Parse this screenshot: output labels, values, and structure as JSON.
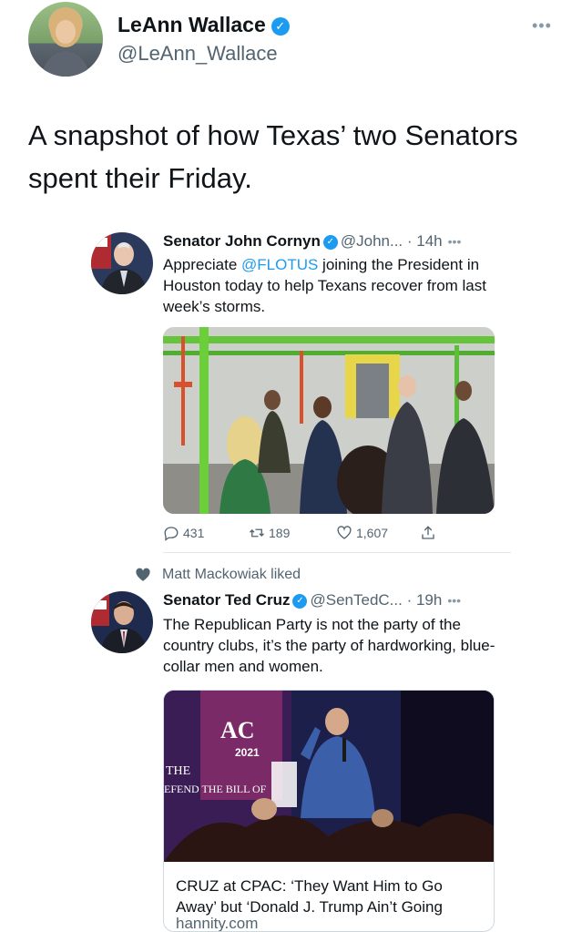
{
  "author": {
    "display_name": "LeAnn Wallace",
    "handle": "@LeAnn_Wallace",
    "more": "•••"
  },
  "tweet": {
    "text": "A snapshot of how Texas’ two Senators spent their Friday."
  },
  "quote1": {
    "name": "Senator John Cornyn",
    "handle": "@John...",
    "time": "· 14h",
    "more": "•••",
    "text_pre": "Appreciate ",
    "mention": "@FLOTUS",
    "text_post": " joining the President in Houston today to help Texans recover from last week’s storms.",
    "replies": "431",
    "retweets": "189",
    "likes": "1,607"
  },
  "liked_by": {
    "text": "Matt Mackowiak liked"
  },
  "quote2": {
    "name": "Senator Ted Cruz",
    "handle": "@SenTedC...",
    "time": "· 19h",
    "more": "•••",
    "text": "The Republican Party is not the party of the country clubs, it’s the party of hardworking, blue-collar men and women.",
    "card_sign_1": "AC",
    "card_sign_2": "2021",
    "card_sign_3": "THE",
    "card_sign_4": "EFEND THE BILL OF",
    "card_title": "CRUZ at CPAC: ‘They Want Him to Go Away’ but ‘Donald J. Trump Ain’t Going",
    "card_domain": "hannity.com"
  },
  "colors": {
    "accent": "#1d9bf0",
    "muted": "#536471",
    "text": "#0f1419"
  }
}
